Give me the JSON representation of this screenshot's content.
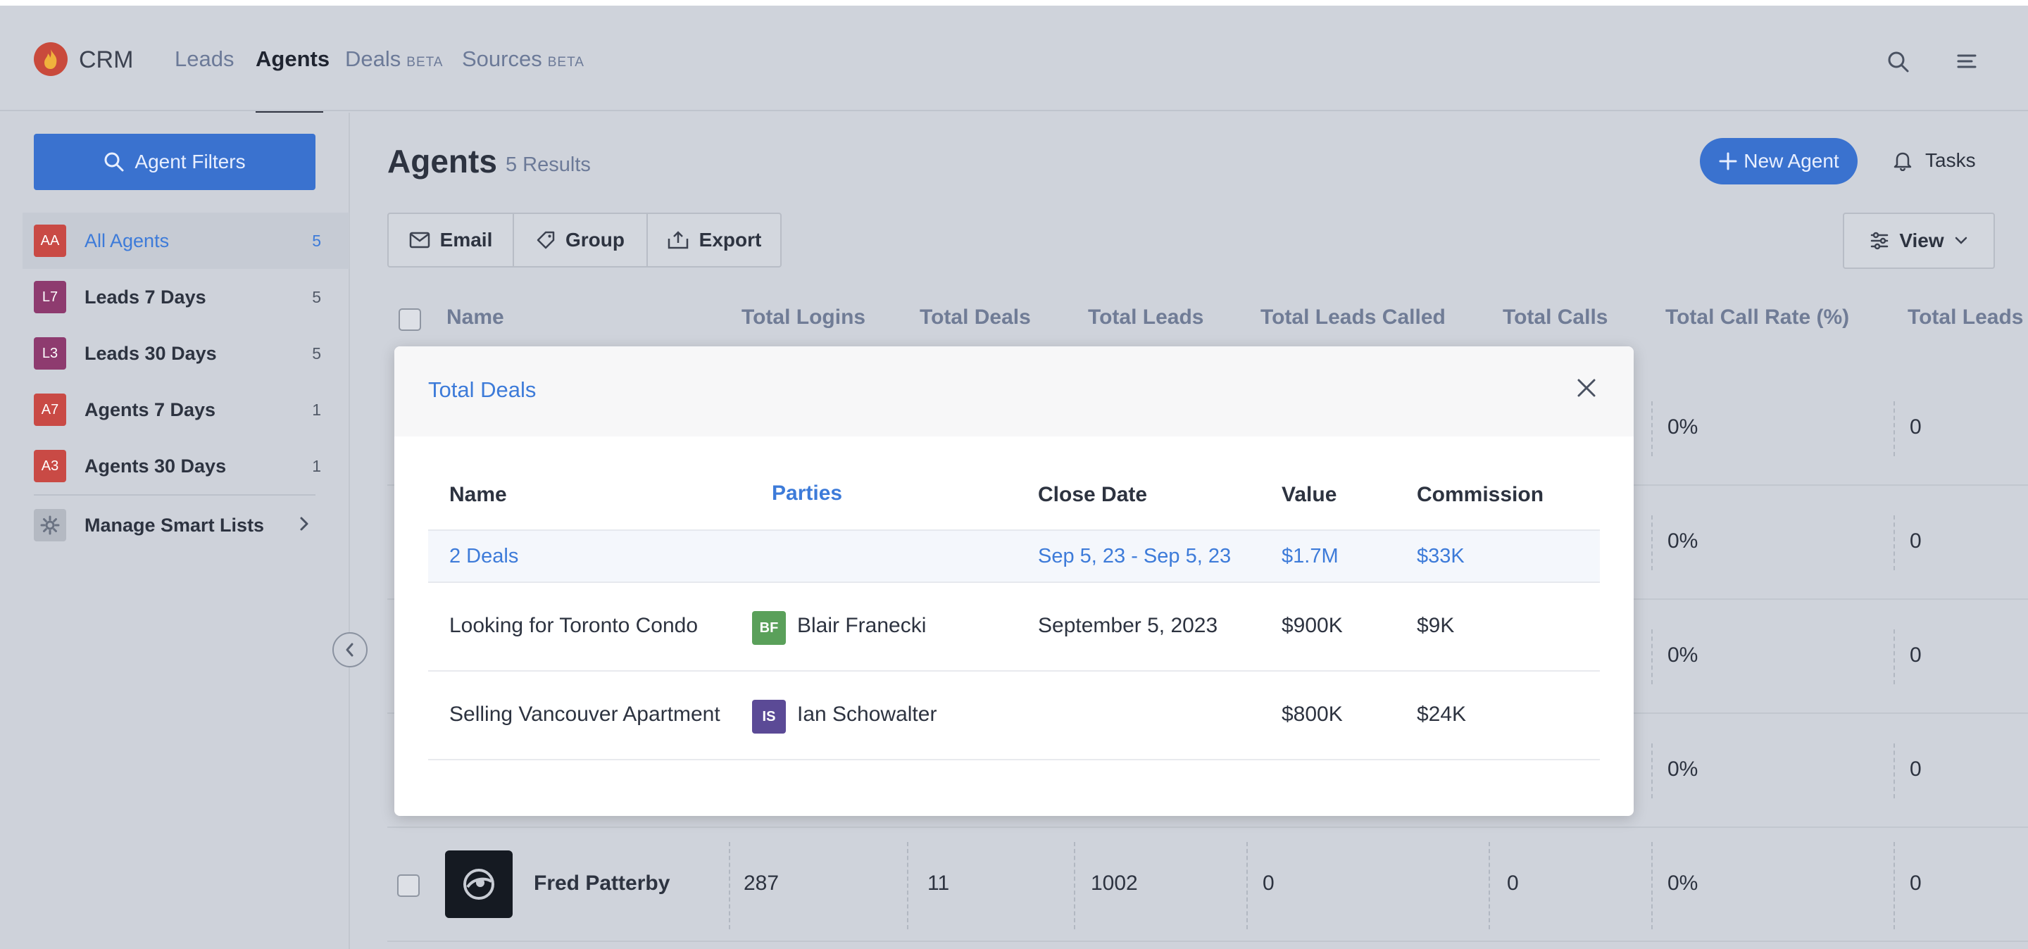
{
  "nav": {
    "brand": "CRM",
    "links": [
      {
        "label": "Leads",
        "beta": ""
      },
      {
        "label": "Agents",
        "beta": ""
      },
      {
        "label": "Deals",
        "beta": "BETA"
      },
      {
        "label": "Sources",
        "beta": "BETA"
      }
    ]
  },
  "sidebar": {
    "filter_button": "Agent Filters",
    "items": [
      {
        "badge": "AA",
        "label": "All Agents",
        "count": "5",
        "color": "#c94a45"
      },
      {
        "badge": "L7",
        "label": "Leads 7 Days",
        "count": "5",
        "color": "#8e3b6f"
      },
      {
        "badge": "L3",
        "label": "Leads 30 Days",
        "count": "5",
        "color": "#8e3b6f"
      },
      {
        "badge": "A7",
        "label": "Agents 7 Days",
        "count": "1",
        "color": "#c94a45"
      },
      {
        "badge": "A3",
        "label": "Agents 30 Days",
        "count": "1",
        "color": "#c94a45"
      }
    ],
    "manage": "Manage Smart Lists"
  },
  "main": {
    "title": "Agents",
    "results": "5 Results",
    "new_agent": "New Agent",
    "tasks": "Tasks",
    "actions": [
      "Email",
      "Group",
      "Export"
    ],
    "view": "View",
    "columns": [
      "Name",
      "Total Logins",
      "Total Deals",
      "Total Leads",
      "Total Leads Called",
      "Total Calls",
      "Total Call Rate (%)",
      "Total Leads"
    ],
    "rows": [
      {
        "call_rate": "0%",
        "leads_last": "0"
      },
      {
        "call_rate": "0%",
        "leads_last": "0"
      },
      {
        "call_rate": "0%",
        "leads_last": "0"
      },
      {
        "call_rate": "0%",
        "leads_last": "0"
      }
    ],
    "last_row": {
      "name": "Fred Patterby",
      "logins": "287",
      "deals": "11",
      "leads": "1002",
      "leads_called": "0",
      "calls": "0",
      "call_rate": "0%",
      "leads_last": "0"
    }
  },
  "modal": {
    "title": "Total Deals",
    "headers": {
      "name": "Name",
      "parties": "Parties",
      "close_date": "Close Date",
      "value": "Value",
      "commission": "Commission"
    },
    "summary": {
      "name": "2 Deals",
      "close_date": "Sep 5, 23 - Sep 5, 23",
      "value": "$1.7M",
      "commission": "$33K"
    },
    "deals": [
      {
        "name": "Looking for Toronto Condo",
        "party_initials": "BF",
        "party_name": "Blair Franecki",
        "party_color": "#5aa05a",
        "close_date": "September 5, 2023",
        "value": "$900K",
        "commission": "$9K"
      },
      {
        "name": "Selling Vancouver Apartment",
        "party_initials": "IS",
        "party_name": "Ian Schowalter",
        "party_color": "#5b4a96",
        "close_date": "",
        "value": "$800K",
        "commission": "$24K"
      }
    ]
  }
}
